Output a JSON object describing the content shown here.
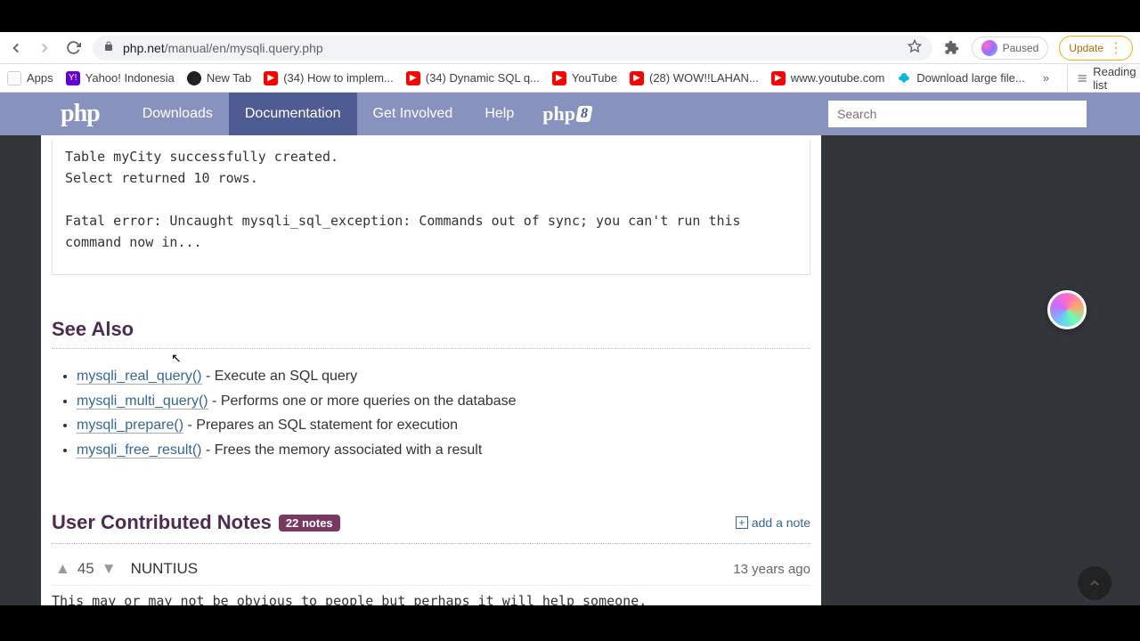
{
  "browser": {
    "url_domain": "php.net",
    "url_path": "/manual/en/mysqli.query.php",
    "profile_status": "Paused",
    "update_label": "Update"
  },
  "bookmarks": {
    "apps": "Apps",
    "yahoo": "Yahoo! Indonesia",
    "newtab": "New Tab",
    "yt1": "(34) How to implem...",
    "yt2": "(34) Dynamic SQL q...",
    "yt3": "YouTube",
    "yt4": "(28) WOW!!LAHAN...",
    "yt5": "www.youtube.com",
    "dl": "Download large file...",
    "reading": "Reading list"
  },
  "php_nav": {
    "logo": "php",
    "items": [
      "Downloads",
      "Documentation",
      "Get Involved",
      "Help"
    ],
    "active_index": 1,
    "php8": "php",
    "search_placeholder": "Search"
  },
  "output": {
    "line1": "Table myCity successfully created.",
    "line2": "Select returned 10 rows.",
    "line3": "Fatal error: Uncaught mysqli_sql_exception: Commands out of sync; you can't run this command now in..."
  },
  "see_also": {
    "heading": "See Also",
    "items": [
      {
        "fn": "mysqli_real_query()",
        "desc": " - Execute an SQL query"
      },
      {
        "fn": "mysqli_multi_query()",
        "desc": " - Performs one or more queries on the database"
      },
      {
        "fn": "mysqli_prepare()",
        "desc": " - Prepares an SQL statement for execution"
      },
      {
        "fn": "mysqli_free_result()",
        "desc": " - Frees the memory associated with a result"
      }
    ]
  },
  "notes": {
    "heading": "User Contributed Notes",
    "badge": "22 notes",
    "add": "add a note",
    "first": {
      "votes": "45",
      "author": "NUNTIUS",
      "age": "13 years ago",
      "body": "This may or may not be obvious to people but perhaps it will help someone."
    }
  }
}
